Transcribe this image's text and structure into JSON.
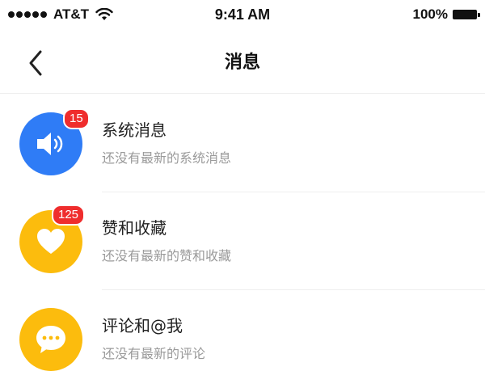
{
  "status_bar": {
    "carrier": "AT&T",
    "time": "9:41 AM",
    "battery": "100%"
  },
  "header": {
    "title": "消息",
    "back_icon": "chevron-left-icon"
  },
  "messages": [
    {
      "title": "系统消息",
      "subtitle": "还没有最新的系统消息",
      "badge": "15",
      "icon": "speaker-icon",
      "icon_color": "#2f7cf6"
    },
    {
      "title": "赞和收藏",
      "subtitle": "还没有最新的赞和收藏",
      "badge": "125",
      "icon": "heart-icon",
      "icon_color": "#fcbc0d"
    },
    {
      "title": "评论和@我",
      "subtitle": "还没有最新的评论",
      "icon": "chat-bubble-icon",
      "icon_color": "#fcbc0d"
    }
  ],
  "colors": {
    "badge": "#ef2d2d",
    "subtitle": "#9a9a9a"
  }
}
